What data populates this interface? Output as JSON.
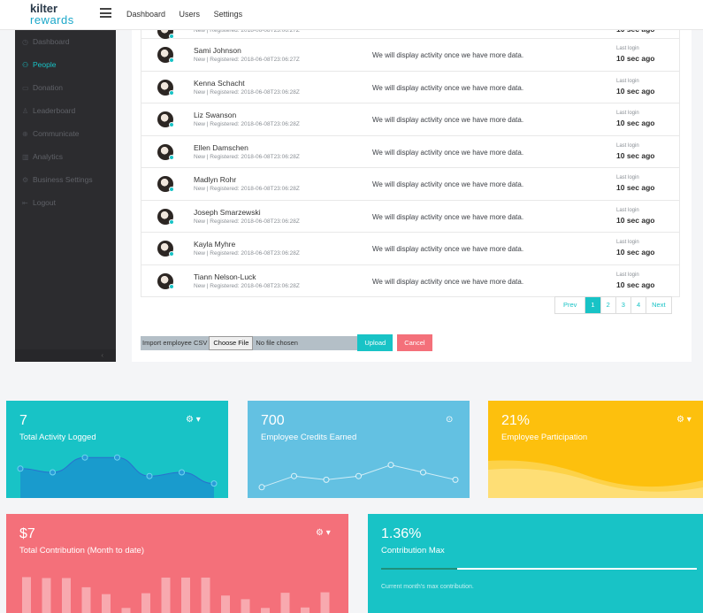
{
  "brand": {
    "line1": "kilter",
    "line2": "rewards"
  },
  "topnav": [
    "Dashboard",
    "Users",
    "Settings"
  ],
  "sidebar": {
    "items": [
      {
        "label": "Dashboard",
        "icon": "dashboard-icon"
      },
      {
        "label": "People",
        "icon": "people-icon"
      },
      {
        "label": "Donation",
        "icon": "donation-icon"
      },
      {
        "label": "Leaderboard",
        "icon": "leaderboard-icon"
      },
      {
        "label": "Communicate",
        "icon": "communicate-icon"
      },
      {
        "label": "Analytics",
        "icon": "analytics-icon"
      },
      {
        "label": "Business Settings",
        "icon": "settings-icon"
      },
      {
        "label": "Logout",
        "icon": "logout-icon"
      }
    ],
    "active": "People"
  },
  "people": {
    "partial_row": {
      "sub": "New | Registered: 2018-06-08T23:06:27Z",
      "last_value": "10 sec ago"
    },
    "rows": [
      {
        "name": "Sami Johnson",
        "sub": "New | Registered: 2018-06-08T23:06:27Z",
        "activity": "We will display activity once we have more data.",
        "last_label": "Last login",
        "last_value": "10 sec ago"
      },
      {
        "name": "Kenna Schacht",
        "sub": "New | Registered: 2018-06-08T23:06:28Z",
        "activity": "We will display activity once we have more data.",
        "last_label": "Last login",
        "last_value": "10 sec ago"
      },
      {
        "name": "Liz Swanson",
        "sub": "New | Registered: 2018-06-08T23:06:28Z",
        "activity": "We will display activity once we have more data.",
        "last_label": "Last login",
        "last_value": "10 sec ago"
      },
      {
        "name": "Ellen Damschen",
        "sub": "New | Registered: 2018-06-08T23:06:28Z",
        "activity": "We will display activity once we have more data.",
        "last_label": "Last login",
        "last_value": "10 sec ago"
      },
      {
        "name": "Madlyn Rohr",
        "sub": "New | Registered: 2018-06-08T23:06:28Z",
        "activity": "We will display activity once we have more data.",
        "last_label": "Last login",
        "last_value": "10 sec ago"
      },
      {
        "name": "Joseph Smarzewski",
        "sub": "New | Registered: 2018-06-08T23:06:28Z",
        "activity": "We will display activity once we have more data.",
        "last_label": "Last login",
        "last_value": "10 sec ago"
      },
      {
        "name": "Kayla Myhre",
        "sub": "New | Registered: 2018-06-08T23:06:28Z",
        "activity": "We will display activity once we have more data.",
        "last_label": "Last login",
        "last_value": "10 sec ago"
      },
      {
        "name": "Tiann Nelson-Luck",
        "sub": "New | Registered: 2018-06-08T23:06:28Z",
        "activity": "We will display activity once we have more data.",
        "last_label": "Last login",
        "last_value": "10 sec ago"
      }
    ]
  },
  "pagination": {
    "prev": "Prev",
    "pages": [
      "1",
      "2",
      "3",
      "4"
    ],
    "current": "1",
    "next": "Next"
  },
  "import": {
    "label": "Import employee CSV",
    "choose": "Choose File",
    "file": "No file chosen",
    "upload": "Upload",
    "cancel": "Cancel"
  },
  "cards": {
    "activity": {
      "value": "7",
      "label": "Total Activity Logged",
      "tool_icon": "gear-icon",
      "color": "#18c3c6",
      "spark": [
        6,
        5,
        9,
        9,
        4,
        5,
        2
      ]
    },
    "credits": {
      "value": "700",
      "label": "Employee Credits Earned",
      "tool_icon": "location-pin-icon",
      "color": "#63c1e2",
      "spark": [
        1,
        4,
        3,
        4,
        7,
        5,
        3
      ]
    },
    "participation": {
      "value": "21%",
      "label": "Employee Participation",
      "tool_icon": "gear-icon",
      "color": "#fdc00d"
    },
    "contribution": {
      "value": "$7",
      "label": "Total Contribution (Month to date)",
      "tool_icon": "gear-icon",
      "color": "#f4707a",
      "bars": [
        78,
        76,
        76,
        56,
        41,
        11,
        43,
        77,
        77,
        77,
        38,
        30,
        11,
        44,
        12,
        45
      ]
    },
    "max": {
      "value": "1.36%",
      "label": "Contribution Max",
      "hint": "Current month's max contribution.",
      "color": "#18c3c6",
      "progress_fraction": 0.24
    }
  }
}
